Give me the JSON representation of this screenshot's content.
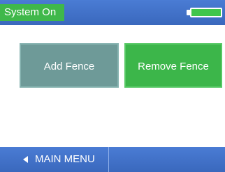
{
  "status": {
    "label": "System On",
    "battery_icon": "battery-full-icon",
    "pill_color": "#3fb84a",
    "bar_color": "#3f72cc"
  },
  "actions": {
    "add_fence_label": "Add  Fence",
    "remove_fence_label": "Remove Fence",
    "add_color": "#6e9a98",
    "remove_color": "#3cb64a"
  },
  "nav": {
    "main_menu_label": "MAIN MENU",
    "back_icon": "back-arrow-icon"
  }
}
